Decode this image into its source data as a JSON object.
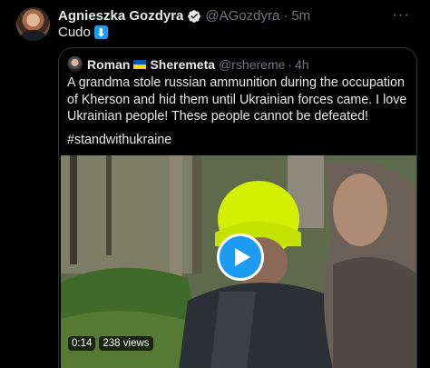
{
  "tweet": {
    "author_name": "Agnieszka Gozdyra",
    "author_handle": "@AGozdyra",
    "separator": "·",
    "time": "5m",
    "text": "Cudo",
    "emoji": "⬇",
    "more_icon": "more-horizontal-icon"
  },
  "quote": {
    "author_name_first": "Roman",
    "author_name_last": "Sheremeta",
    "author_handle": "@rshereme",
    "separator": "·",
    "time": "4h",
    "text": "A grandma stole russian ammunition during the occupation of Kherson and hid them until Ukrainian forces came. I love Ukrainian people! These people cannot be defeated!",
    "hashtag": "#standwithukraine"
  },
  "video": {
    "duration": "0:14",
    "views": "238 views",
    "play_icon": "play-icon"
  },
  "colors": {
    "background": "#000000",
    "accent": "#1d9bf0",
    "text_primary": "#e7e9ea",
    "text_secondary": "#71767b",
    "border": "#2f3336"
  }
}
